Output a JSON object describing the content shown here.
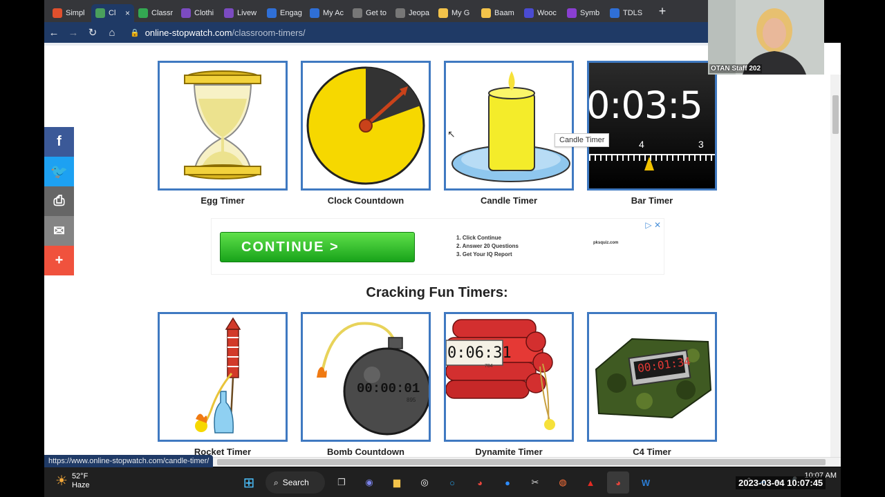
{
  "browser": {
    "tabs": [
      {
        "label": "Simpl",
        "color": "#e0502d",
        "active": false
      },
      {
        "label": "Cl",
        "color": "#4aa05c",
        "active": true
      },
      {
        "label": "Classr",
        "color": "#33a852",
        "active": false
      },
      {
        "label": "Clothi",
        "color": "#7b4bc1",
        "active": false
      },
      {
        "label": "Livew",
        "color": "#7b4bc1",
        "active": false
      },
      {
        "label": "Engag",
        "color": "#2f6fd6",
        "active": false
      },
      {
        "label": "My Ac",
        "color": "#2f6fd6",
        "active": false
      },
      {
        "label": "Get to",
        "color": "#777777",
        "active": false
      },
      {
        "label": "Jeopa",
        "color": "#777777",
        "active": false
      },
      {
        "label": "My G",
        "color": "#f3c34a",
        "active": false
      },
      {
        "label": "Baam",
        "color": "#f3c34a",
        "active": false
      },
      {
        "label": "Wooc",
        "color": "#4a4bd1",
        "active": false
      },
      {
        "label": "Symb",
        "color": "#8a3fd1",
        "active": false
      },
      {
        "label": "TDLS",
        "color": "#2f6fd6",
        "active": false
      }
    ],
    "new_tab_symbol": "+",
    "close_symbol": "×",
    "url_host": "online-stopwatch.com",
    "url_path": "/classroom-timers/",
    "status_url": "https://www.online-stopwatch.com/candle-timer/"
  },
  "social": [
    {
      "icon": "facebook-icon",
      "glyph": "f",
      "color": "#3b5998"
    },
    {
      "icon": "twitter-icon",
      "glyph": "🐦",
      "color": "#1da1f2"
    },
    {
      "icon": "print-icon",
      "glyph": "⎙",
      "color": "#666666"
    },
    {
      "icon": "email-icon",
      "glyph": "✉",
      "color": "#848484"
    },
    {
      "icon": "share-icon",
      "glyph": "+",
      "color": "#f0523d"
    }
  ],
  "timers_row1": [
    {
      "label": "Egg Timer",
      "id": "egg"
    },
    {
      "label": "Clock Countdown",
      "id": "clock"
    },
    {
      "label": "Candle Timer",
      "id": "candle"
    },
    {
      "label": "Bar Timer",
      "id": "bar"
    }
  ],
  "bar_timer_display": "0:03:5",
  "bar_timer_ticks": [
    "4",
    "3"
  ],
  "tooltip": "Candle Timer",
  "ad": {
    "button": "CONTINUE >",
    "steps": [
      "1. Click Continue",
      "2. Answer 20 Questions",
      "3. Get Your IQ Report"
    ],
    "site": "pksquiz.com"
  },
  "section_title": "Cracking Fun Timers:",
  "timers_row2": [
    {
      "label": "Rocket Timer",
      "id": "rocket"
    },
    {
      "label": "Bomb Countdown",
      "id": "bomb"
    },
    {
      "label": "Dynamite Timer",
      "id": "dynamite"
    },
    {
      "label": "C4 Timer",
      "id": "c4"
    }
  ],
  "bomb_display": "00:00:01",
  "bomb_sub": "895",
  "dynamite_display": "0:06:31",
  "dynamite_sub": "784",
  "c4_display": "00:01:34",
  "video": {
    "name": "OTAN Staff 202"
  },
  "taskbar": {
    "temp": "52°F",
    "condition": "Haze",
    "search": "Search",
    "time": "10:07 AM",
    "stamp": "2023-03-04 10:07:45"
  },
  "colors": {
    "card_border": "#3f79c1",
    "chrome_dark": "#35363a",
    "chrome_nav": "#1f3a66"
  }
}
